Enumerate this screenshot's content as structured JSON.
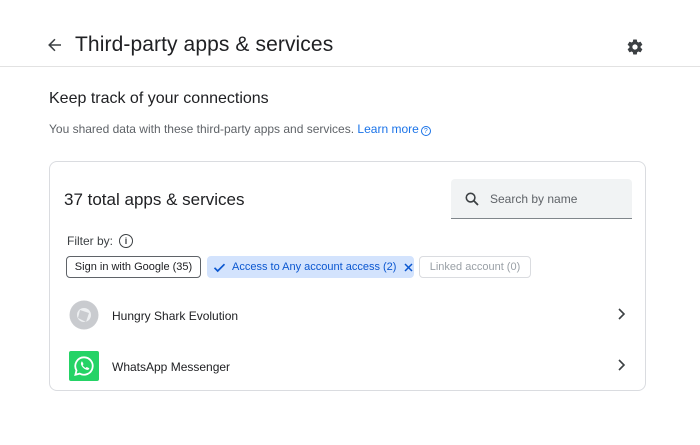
{
  "header": {
    "title": "Third-party apps & services"
  },
  "intro": {
    "heading": "Keep track of your connections",
    "description": "You shared data with these third-party apps and services.",
    "learn_more": "Learn more"
  },
  "card": {
    "total_label": "37 total apps & services",
    "search_placeholder": "Search by name",
    "filter_label": "Filter by:",
    "chips": [
      {
        "label": "Sign in with Google (35)",
        "selected": false,
        "enabled": true
      },
      {
        "label": "Access to Any account access (2)",
        "selected": true,
        "enabled": true
      },
      {
        "label": "Linked account (0)",
        "selected": false,
        "enabled": false
      }
    ],
    "apps": [
      {
        "name": "Hungry Shark Evolution",
        "icon": "placeholder-app-icon"
      },
      {
        "name": "WhatsApp Messenger",
        "icon": "whatsapp-icon"
      }
    ]
  },
  "colors": {
    "accent": "#1a73e8",
    "chip_selected_bg": "#d3e3fd",
    "chip_selected_text": "#0b57d0",
    "whatsapp_green": "#25d366"
  }
}
